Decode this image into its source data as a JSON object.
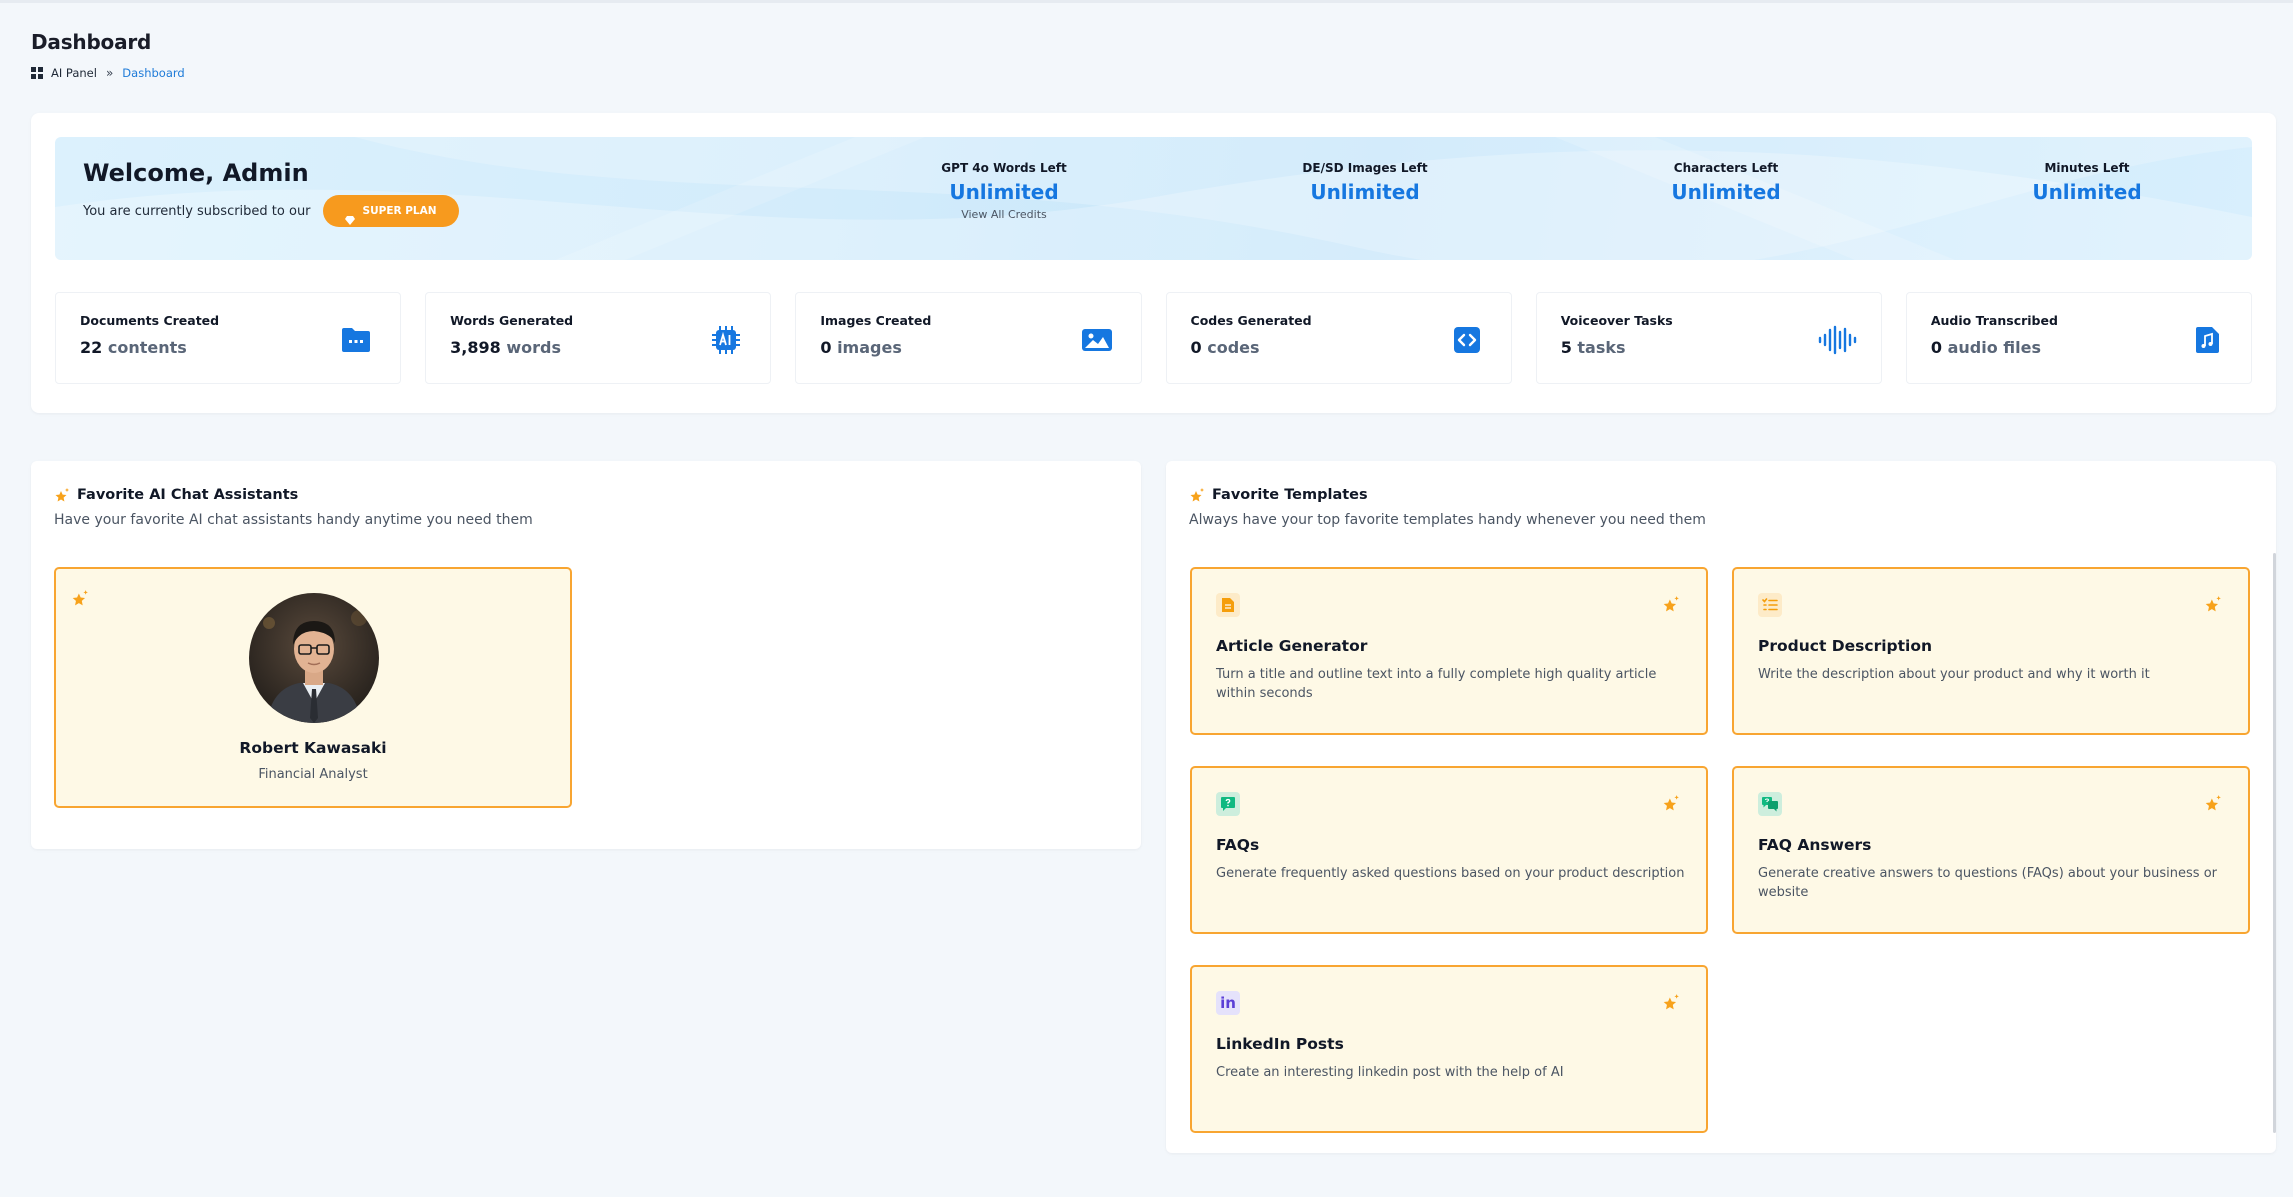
{
  "page": {
    "title": "Dashboard",
    "breadcrumb": {
      "root": "AI Panel",
      "separator": "»",
      "current": "Dashboard"
    }
  },
  "welcome": {
    "title": "Welcome, Admin",
    "subtitle": "You are currently subscribed to our",
    "plan_label": "SUPER PLAN"
  },
  "credits": [
    {
      "label": "GPT 4o Words Left",
      "value": "Unlimited",
      "link": "View All Credits"
    },
    {
      "label": "DE/SD Images Left",
      "value": "Unlimited"
    },
    {
      "label": "Characters Left",
      "value": "Unlimited"
    },
    {
      "label": "Minutes Left",
      "value": "Unlimited"
    }
  ],
  "stats": [
    {
      "label": "Documents Created",
      "count": "22",
      "unit": "contents",
      "icon": "folder-icon"
    },
    {
      "label": "Words Generated",
      "count": "3,898",
      "unit": "words",
      "icon": "ai-chip-icon"
    },
    {
      "label": "Images Created",
      "count": "0",
      "unit": "images",
      "icon": "image-icon"
    },
    {
      "label": "Codes Generated",
      "count": "0",
      "unit": "codes",
      "icon": "code-icon"
    },
    {
      "label": "Voiceover Tasks",
      "count": "5",
      "unit": "tasks",
      "icon": "soundwave-icon"
    },
    {
      "label": "Audio Transcribed",
      "count": "0",
      "unit": "audio files",
      "icon": "music-file-icon"
    }
  ],
  "assistants_panel": {
    "title": "Favorite AI Chat Assistants",
    "description": "Have your favorite AI chat assistants handy anytime you need them",
    "items": [
      {
        "name": "Robert Kawasaki",
        "role": "Financial Analyst"
      }
    ]
  },
  "templates_panel": {
    "title": "Favorite Templates",
    "description": "Always have your top favorite templates handy whenever you need them",
    "items": [
      {
        "title": "Article Generator",
        "description": "Turn a title and outline text into a fully complete high quality article within seconds",
        "icon": "document-icon",
        "icon_label": ""
      },
      {
        "title": "Product Description",
        "description": "Write the description about your product and why it worth it",
        "icon": "list-icon",
        "icon_label": ""
      },
      {
        "title": "FAQs",
        "description": "Generate frequently asked questions based on your product description",
        "icon": "question-chat-icon",
        "icon_label": ""
      },
      {
        "title": "FAQ Answers",
        "description": "Generate creative answers to questions (FAQs) about your business or website",
        "icon": "answer-chat-icon",
        "icon_label": ""
      },
      {
        "title": "LinkedIn Posts",
        "description": "Create an interesting linkedin post with the help of AI",
        "icon": "linkedin-icon",
        "icon_label": "in"
      }
    ]
  },
  "colors": {
    "accent_blue": "#1677e0",
    "accent_orange": "#f8a531",
    "card_bg": "#fef9e6"
  }
}
